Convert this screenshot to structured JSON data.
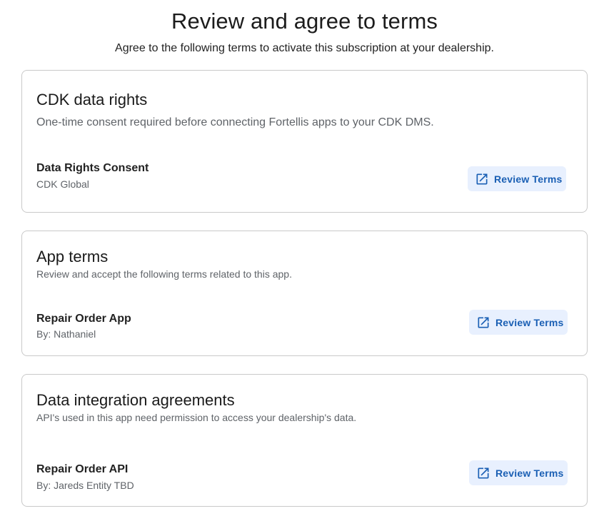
{
  "header": {
    "title": "Review and agree to terms",
    "subtitle": "Agree to the following terms to activate this subscription at your dealership."
  },
  "sections": [
    {
      "title": "CDK data rights",
      "description": "One-time consent required before connecting Fortellis apps to your CDK DMS.",
      "item_name": "Data Rights Consent",
      "item_sub": "CDK Global",
      "button_label": "Review Terms",
      "button_icon": "open-in-new-icon"
    },
    {
      "title": "App terms",
      "description": "Review and accept the following terms related to this app.",
      "item_name": "Repair Order App",
      "item_sub": "By: Nathaniel",
      "button_label": "Review Terms",
      "button_icon": "open-in-new-icon"
    },
    {
      "title": "Data integration agreements",
      "description": "API's used in this app need permission to access your dealership's data.",
      "item_name": "Repair Order API",
      "item_sub": "By: Jareds Entity TBD",
      "button_label": "Review Terms",
      "button_icon": "open-in-new-icon"
    }
  ],
  "colors": {
    "accent": "#1a5fb4",
    "button_bg": "#e8f0fe",
    "border": "#c9c9c9",
    "muted_text": "#5f6368"
  }
}
